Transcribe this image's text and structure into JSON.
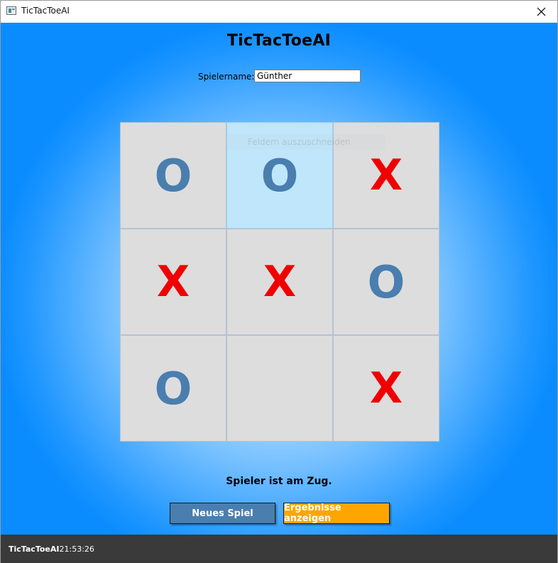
{
  "window": {
    "title": "TicTacToeAI",
    "icon": "app-window-icon",
    "close_icon": "close-icon"
  },
  "main": {
    "heading": "TicTacToeAI",
    "player_label": "Spielername:",
    "player_name": "Günther",
    "tooltip_ghost": "Feldern auszuschneiden",
    "board": [
      [
        "O",
        "O",
        "X"
      ],
      [
        "X",
        "X",
        "O"
      ],
      [
        "O",
        "",
        "X"
      ]
    ],
    "status": "Spieler ist am Zug.",
    "new_game_label": "Neues Spiel",
    "results_label": "Ergebnisse anzeigen"
  },
  "footer": {
    "app_name": "TicTacToeAI",
    "time": "21:53:26"
  },
  "colors": {
    "o_mark": "#4a7eaf",
    "x_mark": "#f00000",
    "new_game_button": "#4a7eaf",
    "results_button": "#ffa500",
    "footer_bg": "#3a3a3a"
  }
}
